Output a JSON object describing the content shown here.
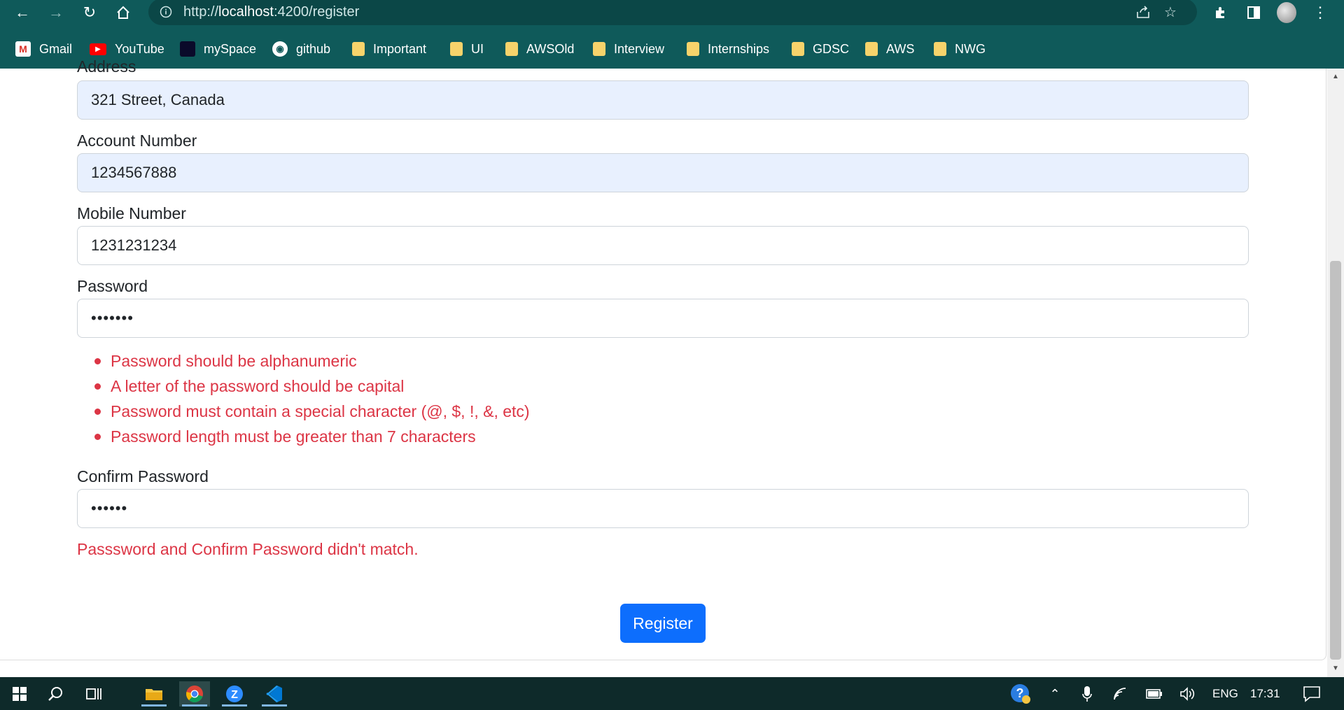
{
  "browser": {
    "url_scheme": "http://",
    "url_host": "localhost",
    "url_rest": ":4200/register",
    "nav_icons": [
      "back-arrow-icon",
      "forward-arrow-icon",
      "reload-icon",
      "home-icon"
    ],
    "right_icons": [
      "share-icon",
      "star-icon",
      "extensions-icon",
      "sidebar-icon",
      "profile-avatar",
      "menu-icon"
    ],
    "bookmarks": [
      {
        "label": "Gmail",
        "icon": "gmail-icon"
      },
      {
        "label": "YouTube",
        "icon": "youtube-icon"
      },
      {
        "label": "mySpace",
        "icon": "myspace-icon"
      },
      {
        "label": "github",
        "icon": "github-icon"
      },
      {
        "label": "Important",
        "icon": "folder-icon"
      },
      {
        "label": "UI",
        "icon": "folder-icon"
      },
      {
        "label": "AWSOld",
        "icon": "folder-icon"
      },
      {
        "label": "Interview",
        "icon": "folder-icon"
      },
      {
        "label": "Internships",
        "icon": "folder-icon"
      },
      {
        "label": "GDSC",
        "icon": "folder-icon"
      },
      {
        "label": "AWS",
        "icon": "folder-icon"
      },
      {
        "label": "NWG",
        "icon": "folder-icon"
      }
    ]
  },
  "form": {
    "address_label": "Address",
    "address_value": "321 Street, Canada",
    "account_label": "Account Number",
    "account_value": "1234567888",
    "mobile_label": "Mobile Number",
    "mobile_value": "1231231234",
    "password_label": "Password",
    "password_value": "•••••••",
    "password_errors": [
      "Password should be alphanumeric",
      "A letter of the password should be capital",
      "Password must contain a special character (@, $, !, &, etc)",
      "Password length must be greater than 7 characters"
    ],
    "confirm_label": "Confirm Password",
    "confirm_value": "••••••",
    "match_error": "Passsword and Confirm Password didn't match.",
    "register_label": "Register"
  },
  "taskbar": {
    "language": "ENG",
    "time": "17:31"
  },
  "colors": {
    "chrome": "#0f5a5a",
    "error": "#dc3545",
    "primary": "#0d6efd",
    "autofill": "#e8f0fe",
    "taskbar": "#0e2a2a"
  }
}
